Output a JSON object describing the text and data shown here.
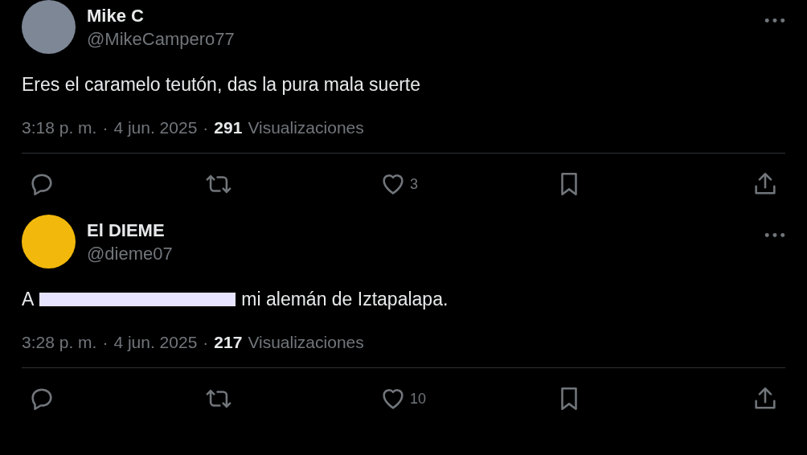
{
  "tweets": [
    {
      "name": "Mike C",
      "handle": "@MikeCampero77",
      "body": [
        {
          "kind": "text",
          "value": "Eres el caramelo teutón, das la pura mala suerte"
        }
      ],
      "meta": [
        {
          "kind": "text",
          "value": "3:18 p. m."
        },
        {
          "kind": "sep",
          "value": "·"
        },
        {
          "kind": "text",
          "value": "4 jun. 2025"
        },
        {
          "kind": "sep",
          "value": "·"
        },
        {
          "kind": "count",
          "value": "291"
        },
        {
          "kind": "text",
          "value": "Visualizaciones"
        }
      ],
      "actions": [
        {
          "kind": "reply"
        },
        {
          "kind": "repost"
        },
        {
          "kind": "like",
          "count": "3"
        },
        {
          "kind": "bookmark"
        },
        {
          "kind": "share"
        }
      ]
    },
    {
      "name": "El DIEME",
      "handle": "@dieme07",
      "body": [
        {
          "kind": "text",
          "value": "A"
        },
        {
          "kind": "redaction"
        },
        {
          "kind": "text",
          "value": "mi alemán de Iztapalapa."
        }
      ],
      "meta": [
        {
          "kind": "text",
          "value": "3:28 p. m."
        },
        {
          "kind": "sep",
          "value": "·"
        },
        {
          "kind": "text",
          "value": "4 jun. 2025"
        },
        {
          "kind": "sep",
          "value": "·"
        },
        {
          "kind": "count",
          "value": "217"
        },
        {
          "kind": "text",
          "value": "Visualizaciones"
        }
      ],
      "actions": [
        {
          "kind": "reply"
        },
        {
          "kind": "repost"
        },
        {
          "kind": "like",
          "count": "10"
        },
        {
          "kind": "bookmark"
        },
        {
          "kind": "share"
        }
      ]
    }
  ]
}
